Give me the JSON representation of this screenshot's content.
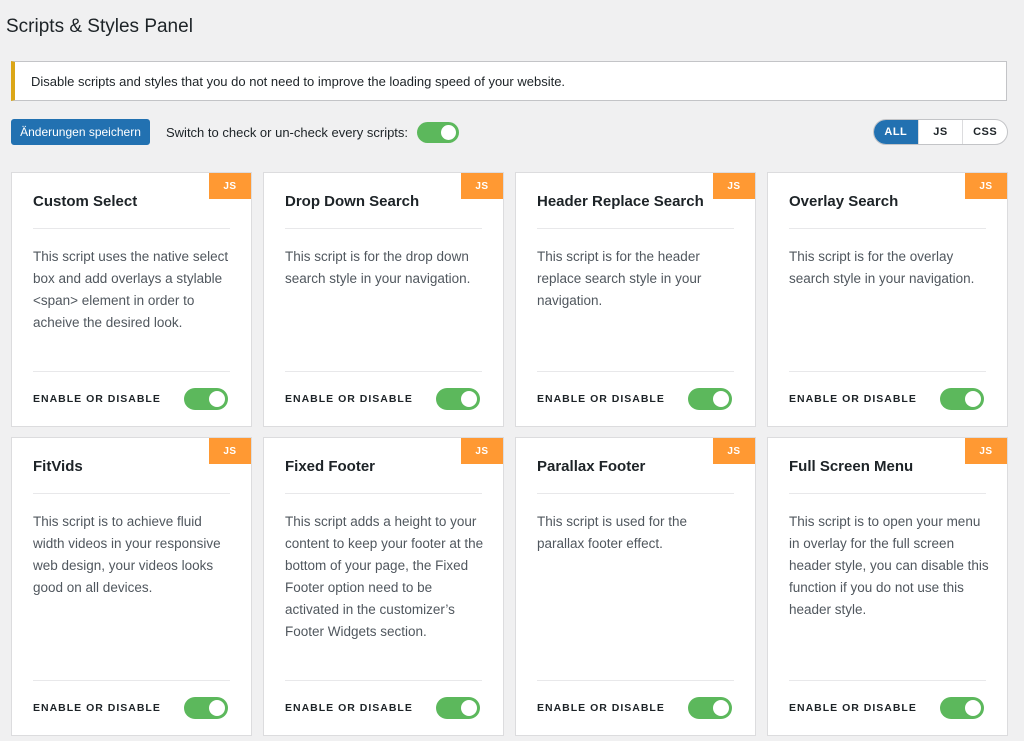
{
  "header": {
    "title": "Scripts & Styles Panel"
  },
  "notice": {
    "text": "Disable scripts and styles that you do not need to improve the loading speed of your website."
  },
  "toolbar": {
    "save_label": "Änderungen speichern",
    "switch_all_label": "Switch to check or un-check every scripts:",
    "switch_all_on": true
  },
  "filters": [
    {
      "label": "ALL",
      "active": true
    },
    {
      "label": "JS",
      "active": false
    },
    {
      "label": "CSS",
      "active": false
    }
  ],
  "colors": {
    "accent": "#2271b1",
    "toggle_on": "#5cb85c",
    "badge": "#ff9933",
    "notice_border": "#dba617"
  },
  "cards": [
    {
      "badge": "JS",
      "title": "Custom Select",
      "description": "This script uses the native select box and add overlays a stylable <span> element in order to acheive the desired look.",
      "footer_label": "ENABLE OR DISABLE",
      "enabled": true
    },
    {
      "badge": "JS",
      "title": "Drop Down Search",
      "description": "This script is for the drop down search style in your navigation.",
      "footer_label": "ENABLE OR DISABLE",
      "enabled": true
    },
    {
      "badge": "JS",
      "title": "Header Replace Search",
      "description": "This script is for the header replace search style in your navigation.",
      "footer_label": "ENABLE OR DISABLE",
      "enabled": true
    },
    {
      "badge": "JS",
      "title": "Overlay Search",
      "description": "This script is for the overlay search style in your navigation.",
      "footer_label": "ENABLE OR DISABLE",
      "enabled": true
    },
    {
      "badge": "JS",
      "title": "FitVids",
      "description": "This script is to achieve fluid width videos in your responsive web design, your videos looks good on all devices.",
      "footer_label": "ENABLE OR DISABLE",
      "enabled": true
    },
    {
      "badge": "JS",
      "title": "Fixed Footer",
      "description": "This script adds a height to your content to keep your footer at the bottom of your page, the Fixed Footer option need to be activated in the customizer’s Footer Widgets section.",
      "footer_label": "ENABLE OR DISABLE",
      "enabled": true
    },
    {
      "badge": "JS",
      "title": "Parallax Footer",
      "description": "This script is used for the parallax footer effect.",
      "footer_label": "ENABLE OR DISABLE",
      "enabled": true
    },
    {
      "badge": "JS",
      "title": "Full Screen Menu",
      "description": "This script is to open your menu in overlay for the full screen header style, you can disable this function if you do not use this header style.",
      "footer_label": "ENABLE OR DISABLE",
      "enabled": true
    }
  ]
}
